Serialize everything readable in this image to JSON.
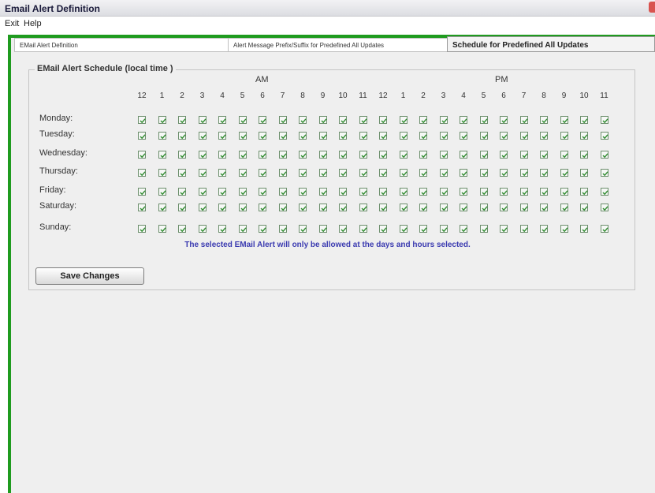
{
  "window": {
    "title": "Email Alert Definition"
  },
  "menu": [
    {
      "label": "Exit",
      "mnemonic": "x"
    },
    {
      "label": "Help",
      "mnemonic": "H"
    }
  ],
  "tabs": [
    {
      "label": "EMail Alert Definition",
      "active": false
    },
    {
      "label": "Alert Message Prefix/Suffix for Predefined All Updates",
      "active": false
    },
    {
      "label": "Schedule for Predefined All Updates",
      "active": true
    }
  ],
  "schedule": {
    "group_title": "EMail Alert Schedule (local time )",
    "am_label": "AM",
    "pm_label": "PM",
    "hours": [
      "12",
      "1",
      "2",
      "3",
      "4",
      "5",
      "6",
      "7",
      "8",
      "9",
      "10",
      "11",
      "12",
      "1",
      "2",
      "3",
      "4",
      "5",
      "6",
      "7",
      "8",
      "9",
      "10",
      "11"
    ],
    "days": [
      "Monday:",
      "Tuesday:",
      "Wednesday:",
      "Thursday:",
      "Friday:",
      "Saturday:",
      "Sunday:"
    ],
    "all_checked": true,
    "note": "The selected EMail Alert will only be allowed at the days and hours selected.",
    "save_label": "Save Changes"
  },
  "colors": {
    "accent_green": "#1f9b1f",
    "note_blue": "#3a3ab0"
  }
}
